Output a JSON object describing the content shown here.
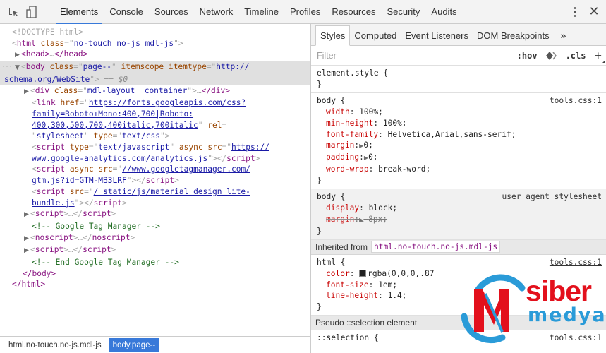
{
  "toolbar": {
    "inspect_icon": "inspect-element-icon",
    "device_icon": "device-toggle-icon",
    "tabs": [
      {
        "label": "Elements",
        "active": true
      },
      {
        "label": "Console"
      },
      {
        "label": "Sources"
      },
      {
        "label": "Network"
      },
      {
        "label": "Timeline"
      },
      {
        "label": "Profiles"
      },
      {
        "label": "Resources"
      },
      {
        "label": "Security"
      },
      {
        "label": "Audits"
      }
    ],
    "menu_icon": "⋮",
    "close_icon": "✕"
  },
  "elements": {
    "doctype": "<!DOCTYPE html>",
    "html_open": {
      "tag": "html",
      "attr": "class",
      "value": "no-touch no-js mdl-js"
    },
    "head": {
      "open": "<head>",
      "ellipsis": "…",
      "close": "</head>"
    },
    "body_open": {
      "tag": "body",
      "attr1": "class",
      "val1": "page--",
      "attr2": "itemscope",
      "attr3": "itemtype",
      "val3_line1": "http://",
      "val3_line2": "schema.org/WebSite",
      "eq": "== ",
      "dollar": "$0"
    },
    "div": {
      "tag": "div",
      "attr": "class",
      "value": "mdl-layout__container"
    },
    "link": {
      "tag": "link",
      "attr": "href",
      "href_lines": [
        "https://fonts.googleapis.com/css?",
        "family=Roboto+Mono:400,700|Roboto:",
        "400,300,500,700,400italic,700italic"
      ],
      "rel_attr": "rel",
      "rel_val": "stylesheet",
      "type_attr": "type",
      "type_val": "text/css"
    },
    "script_ga": {
      "tag": "script",
      "type_attr": "type",
      "type_val": "text/javascript",
      "async_attr": "async",
      "src_attr": "src",
      "src_lines": [
        "https://",
        "www.google-analytics.com/analytics.js"
      ]
    },
    "script_gtm": {
      "tag": "script",
      "async_attr": "async",
      "src_attr": "src",
      "src_lines": [
        "//www.googletagmanager.com/",
        "gtm.js?id=GTM-MB3LRF"
      ]
    },
    "script_mdl": {
      "tag": "script",
      "src_attr": "src",
      "src_lines": [
        "/_static/js/material_design_lite-",
        "bundle.js"
      ]
    },
    "script_collapsed": "script",
    "comment1": "<!-- Google Tag Manager -->",
    "noscript": "noscript",
    "script_collapsed2": "script",
    "comment2": "<!-- End Google Tag Manager -->",
    "body_close": "</body>",
    "html_close": "</html>"
  },
  "breadcrumbs": [
    {
      "label": "html.no-touch.no-js.mdl-js",
      "active": false
    },
    {
      "label": "body.page--",
      "active": true
    }
  ],
  "styles": {
    "subtabs": [
      {
        "label": "Styles",
        "active": true
      },
      {
        "label": "Computed"
      },
      {
        "label": "Event Listeners"
      },
      {
        "label": "DOM Breakpoints"
      },
      {
        "label": "»"
      }
    ],
    "filter": {
      "placeholder": "Filter",
      "hov": ":hov",
      "cls": ".cls",
      "plus": "+"
    },
    "rules": [
      {
        "selector": "element.style {",
        "close": "}",
        "source": "",
        "declarations": []
      },
      {
        "selector": "body {",
        "close": "}",
        "source": "tools.css:1",
        "declarations": [
          {
            "name": "width",
            "value": "100%;"
          },
          {
            "name": "min-height",
            "value": "100%;"
          },
          {
            "name": "font-family",
            "value": "Helvetica,Arial,sans-serif;"
          },
          {
            "name": "margin",
            "value": "0;",
            "expandable": true
          },
          {
            "name": "padding",
            "value": "0;",
            "expandable": true
          },
          {
            "name": "word-wrap",
            "value": "break-word;"
          }
        ]
      },
      {
        "selector": "body {",
        "close": "}",
        "source": "user agent stylesheet",
        "declarations": [
          {
            "name": "display",
            "value": "block;"
          },
          {
            "name": "margin",
            "value": "8px;",
            "expandable": true,
            "overridden": true
          }
        ]
      }
    ],
    "inherited_label": "Inherited from",
    "inherited_node": "html.no-touch.no-js.mdl-js",
    "html_rule": {
      "selector": "html {",
      "close": "}",
      "source": "tools.css:1",
      "declarations": [
        {
          "name": "color",
          "value": "rgba(0,0,0,.87",
          "swatch": "#000000"
        },
        {
          "name": "font-size",
          "value": "1em;"
        },
        {
          "name": "line-height",
          "value": "1.4;"
        }
      ]
    },
    "pseudo_label": "Pseudo ::selection element",
    "selection_rule": {
      "selector": "::selection {",
      "source": "tools.css:1"
    }
  },
  "watermark": {
    "word1": "siber",
    "word2": "medya",
    "red": "#e3101c",
    "blue": "#2a9bd8"
  },
  "colors": {
    "accent": "#3879d9",
    "tag": "#881280",
    "attr": "#994500",
    "value": "#1a1aa6",
    "comment": "#236e25",
    "property": "#c80000"
  }
}
